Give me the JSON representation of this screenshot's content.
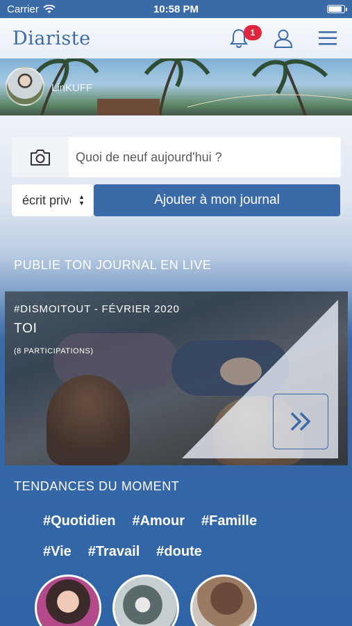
{
  "status_bar": {
    "carrier": "Carrier",
    "time": "10:58 PM"
  },
  "header": {
    "logo_text": "Diariste",
    "notification_count": "1"
  },
  "banner": {
    "username": "LinKUFF"
  },
  "composer": {
    "placeholder": "Quoi de neuf aujourd'hui ?",
    "privacy_value": "écrit privé",
    "add_button_label": "Ajouter à mon journal"
  },
  "live": {
    "section_title": "PUBLIE TON JOURNAL EN LIVE",
    "hashtag": "#DISMOITOUT - FÉVRIER 2020",
    "name": "TOI",
    "participants": "(8 PARTICIPATIONS)"
  },
  "trends": {
    "section_title": "TENDANCES DU MOMENT",
    "tags_row1": [
      "#Quotidien",
      "#Amour",
      "#Famille"
    ],
    "tags_row2": [
      "#Vie",
      "#Travail",
      "#doute"
    ]
  },
  "colors": {
    "primary": "#3a6aa8",
    "badge": "#e0263c"
  }
}
